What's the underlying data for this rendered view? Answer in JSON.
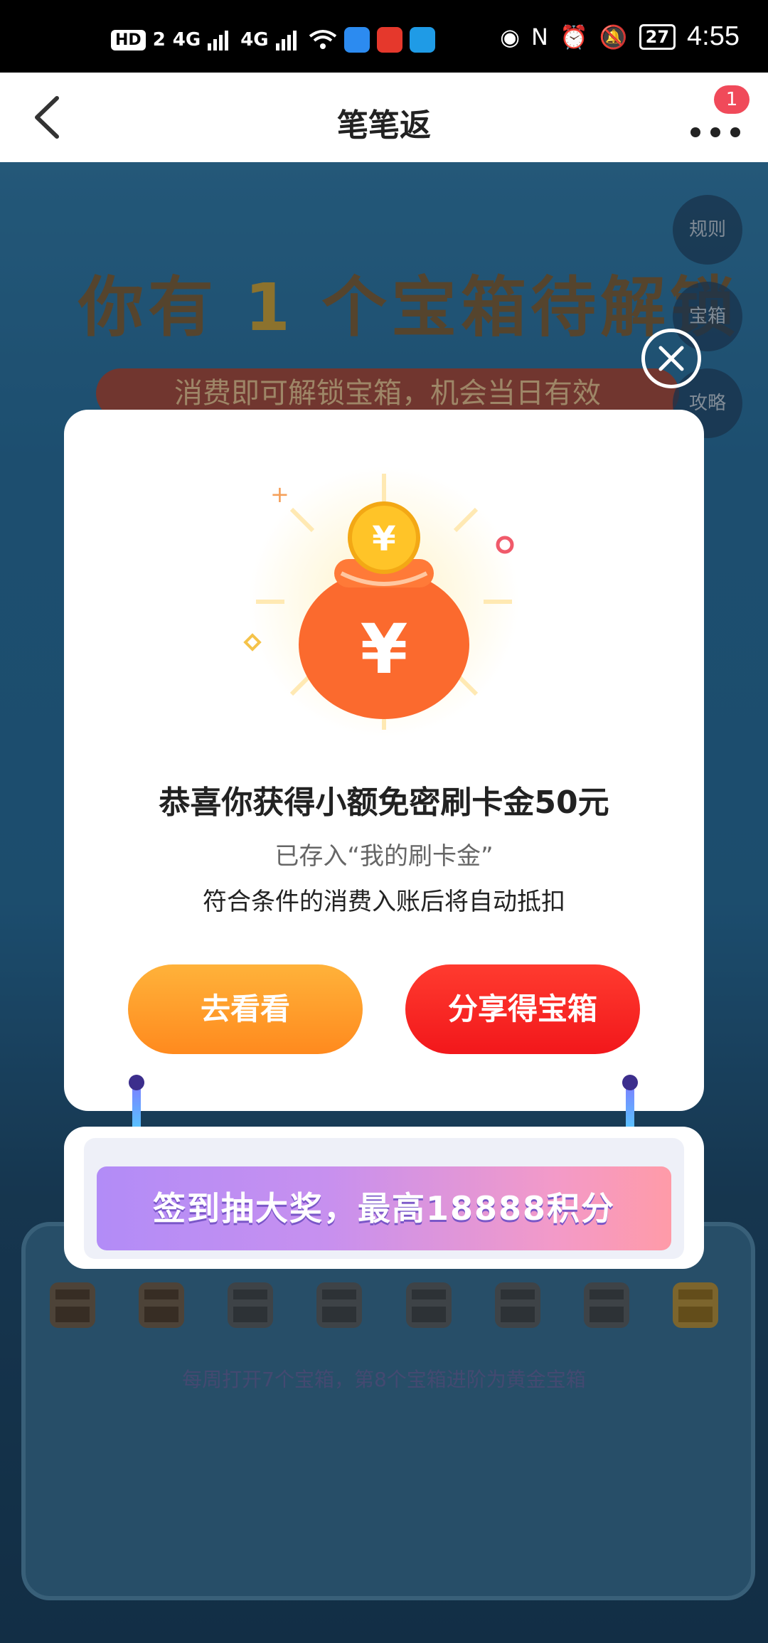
{
  "status_bar": {
    "left_icons": [
      "HD",
      "2",
      "4G",
      "4G",
      "wifi-icon"
    ],
    "battery": "27",
    "time": "4:55"
  },
  "nav": {
    "title": "笔笔返",
    "badge": "1"
  },
  "background": {
    "headline_prefix": "你有",
    "headline_count": "1",
    "headline_suffix": "个宝箱待解锁",
    "subtitle": "消费即可解锁宝箱，机会当日有效",
    "side_buttons": [
      "规则",
      "宝箱",
      "攻略"
    ],
    "chest_note": "每周打开7个宝箱，第8个宝箱进阶为黄金宝箱"
  },
  "modal": {
    "title": "恭喜你获得小额免密刷卡金50元",
    "line1": "已存入“我的刷卡金”",
    "line2": "符合条件的消费入账后将自动抵扣",
    "btn_look": "去看看",
    "btn_share": "分享得宝箱"
  },
  "banner": {
    "text": "签到抽大奖，最高18888积分"
  },
  "colors": {
    "accent_orange": "#ff8a1e",
    "accent_red": "#f2171b",
    "badge_red": "#f04a5a"
  }
}
